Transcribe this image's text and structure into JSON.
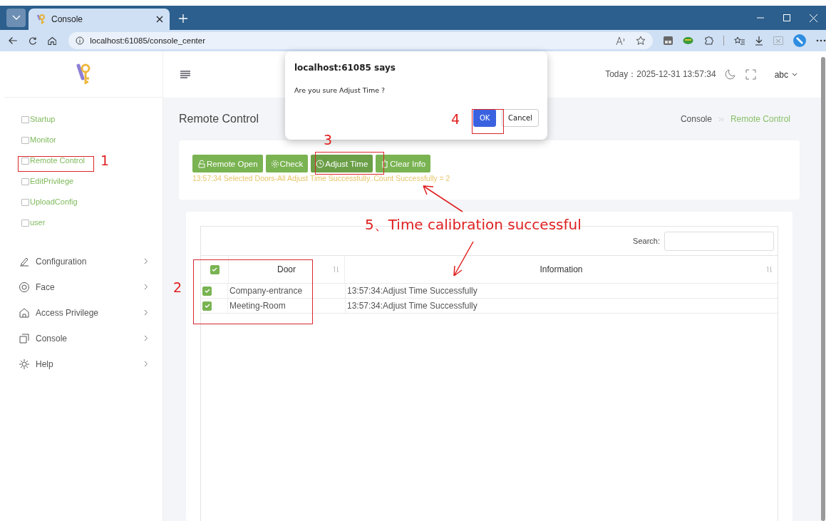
{
  "browser": {
    "tab_title": "Console",
    "url": "localhost:61085/console_center"
  },
  "sidebar": {
    "links": [
      {
        "label": "Startup"
      },
      {
        "label": "Monitor"
      },
      {
        "label": "Remote Control"
      },
      {
        "label": "EditPrivilege"
      },
      {
        "label": "UploadConfig"
      },
      {
        "label": "user"
      }
    ],
    "menus": [
      {
        "label": "Configuration"
      },
      {
        "label": "Face"
      },
      {
        "label": "Access Privilege"
      },
      {
        "label": "Console"
      },
      {
        "label": "Help"
      }
    ]
  },
  "header": {
    "today": "Today：2025-12-31 13:57:34",
    "user": "abc"
  },
  "page": {
    "title": "Remote Control",
    "breadcrumb": [
      "Console",
      "Remote Control"
    ]
  },
  "actions": [
    {
      "label": "Remote Open",
      "selected": false
    },
    {
      "label": "Check",
      "selected": false
    },
    {
      "label": "Adjust Time",
      "selected": true
    },
    {
      "label": "Clear Info",
      "selected": false
    }
  ],
  "status_message": "13:57:34 Selected Doors-All Adjust Time Successfully..Count Successfully = 2",
  "table": {
    "search_label": "Search:",
    "select_all_checked": true,
    "columns": [
      "Door",
      "Information"
    ],
    "rows": [
      {
        "checked": true,
        "door": "Company-entrance",
        "information": "13:57:34:Adjust Time Successfully"
      },
      {
        "checked": true,
        "door": "Meeting-Room",
        "information": "13:57:34:Adjust Time Successfully"
      }
    ]
  },
  "dialog": {
    "title": "localhost:61085 says",
    "message": "Are you sure Adjust Time ?",
    "buttons": [
      "OK",
      "Cancel"
    ]
  },
  "annotations": {
    "markers": [
      "1",
      "2",
      "3",
      "4"
    ],
    "callout": "5、Time calibration successful"
  }
}
